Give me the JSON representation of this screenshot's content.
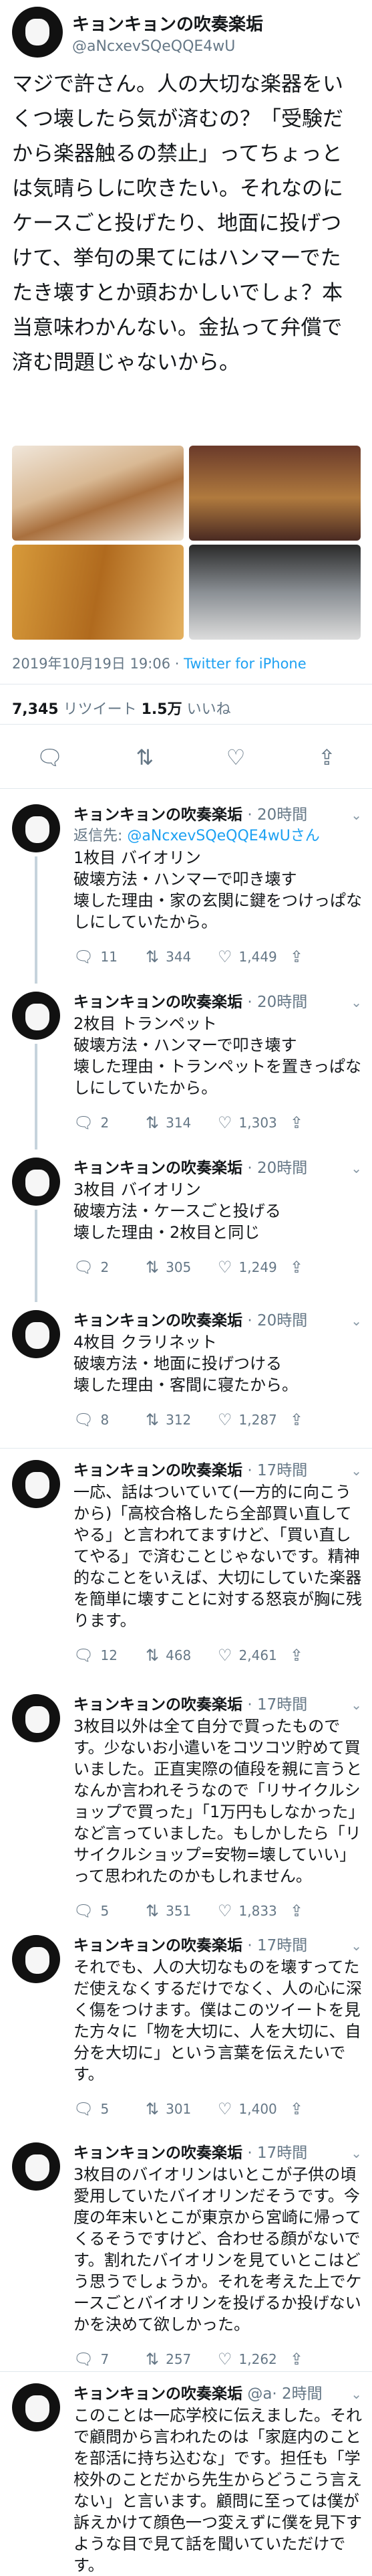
{
  "tweet": {
    "name": "キョンキョンの吹奏楽垢",
    "handle": "@aNcxevSQeQQE4wU",
    "text": "マジで許さん。人の大切な楽器をいくつ壊したら気が済むの？「受験だから楽器触るの禁止」ってちょっとは気晴らしに吹きたい。それなのにケースごと投げたり、地面に投げつけて、挙句の果てにはハンマーでたたき壊すとか頭おかしいでしょ？本当意味わかんない。金払って弁償で済む問題じゃないから。",
    "date": "2019年10月19日 19:06",
    "via": "·",
    "client": "Twitter for iPhone",
    "retweets": "7,345",
    "retweets_label": "リツイート",
    "likes": "1.5万",
    "likes_label": "いいね",
    "icons": [
      "reply-icon",
      "retweet-icon",
      "like-icon",
      "share-icon"
    ]
  },
  "replies": [
    {
      "name": "キョンキョンの吹奏楽垢",
      "sep": "·",
      "time": "20時間",
      "reply_to_prefix": "返信先:",
      "reply_to_handle": "@aNcxevSQeQQE4wUさん",
      "text": "1枚目 バイオリン\n破壊方法・ハンマーで叩き壊す\n壊した理由・家の玄関に鍵をつけっぱなしにしていたから。",
      "replies": "11",
      "retweets": "344",
      "likes": "1,449"
    },
    {
      "name": "キョンキョンの吹奏楽垢",
      "sep": "·",
      "time": "20時間",
      "text": "2枚目 トランペット\n破壊方法・ハンマーで叩き壊す\n壊した理由・トランペットを置きっぱなしにしていたから。",
      "replies": "2",
      "retweets": "314",
      "likes": "1,303"
    },
    {
      "name": "キョンキョンの吹奏楽垢",
      "sep": "·",
      "time": "20時間",
      "text": "3枚目 バイオリン\n破壊方法・ケースごと投げる\n壊した理由・2枚目と同じ",
      "replies": "2",
      "retweets": "305",
      "likes": "1,249"
    },
    {
      "name": "キョンキョンの吹奏楽垢",
      "sep": "·",
      "time": "20時間",
      "text": "4枚目 クラリネット\n破壊方法・地面に投げつける\n壊した理由・客間に寝たから。",
      "replies": "8",
      "retweets": "312",
      "likes": "1,287"
    },
    {
      "name": "キョンキョンの吹奏楽垢",
      "sep": "·",
      "time": "17時間",
      "text": "一応、話はついていて(一方的に向こうから)「高校合格したら全部買い直してやる」と言われてますけど、「買い直してやる」で済むことじゃないです。精神的なことをいえば、大切にしていた楽器を簡単に壊すことに対する怒哀が胸に残ります。",
      "replies": "12",
      "retweets": "468",
      "likes": "2,461"
    },
    {
      "name": "キョンキョンの吹奏楽垢",
      "sep": "·",
      "time": "17時間",
      "text": "3枚目以外は全て自分で買ったものです。少ないお小遣いをコツコツ貯めて買いました。正直実際の値段を親に言うとなんか言われそうなので「リサイクルショップで買った」「1万円もしなかった」など言っていました。もしかしたら「リサイクルショップ=安物=壊していい」って思われたのかもしれません。",
      "replies": "5",
      "retweets": "351",
      "likes": "1,833"
    },
    {
      "name": "キョンキョンの吹奏楽垢",
      "sep": "·",
      "time": "17時間",
      "text": "それでも、人の大切なものを壊すってただ使えなくするだけでなく、人の心に深く傷をつけます。僕はこのツイートを見た方々に「物を大切に、人を大切に、自分を大切に」という言葉を伝えたいです。",
      "replies": "5",
      "retweets": "301",
      "likes": "1,400"
    },
    {
      "name": "キョンキョンの吹奏楽垢",
      "sep": "·",
      "time": "17時間",
      "text": "3枚目のバイオリンはいとこが子供の頃愛用していたバイオリンだそうです。今度の年末いとこが東京から宮崎に帰ってくるそうですけど、合わせる顔がないです。割れたバイオリンを見ていとこはどう思うでしょうか。それを考えた上でケースごとバイオリンを投げるか投げないかを決めて欲しかった。",
      "replies": "7",
      "retweets": "257",
      "likes": "1,262"
    },
    {
      "name": "キョンキョンの吹奏楽垢",
      "sep": "@a·",
      "time": "2時間",
      "text": "このことは一応学校に伝えました。それで顧問から言われたのは「家庭内のことを部活に持ち込むな」です。担任も「学校外のことだから先生からどうこう言えない」と言います。顧問に至っては僕が訴えかけて顔色一つ変えずに僕を見下すような目で見て話を聞いていただけです。",
      "replies": "",
      "retweets": "",
      "likes": ""
    }
  ]
}
